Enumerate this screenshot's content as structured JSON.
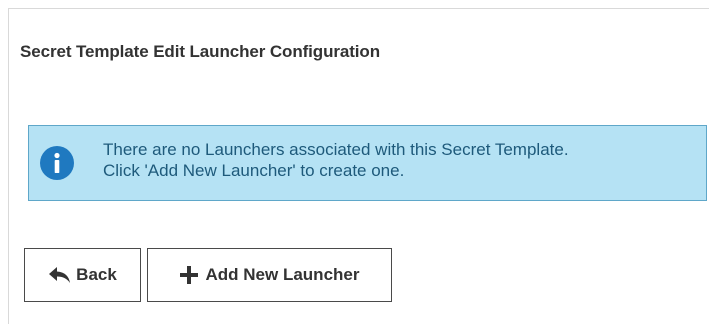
{
  "page": {
    "title": "Secret Template Edit Launcher Configuration"
  },
  "alert": {
    "type": "info",
    "icon": "info-icon",
    "line1": "There are no Launchers associated with this Secret Template.",
    "line2": "Click 'Add New Launcher' to create one."
  },
  "buttons": {
    "back_label": "Back",
    "back_icon": "reply-arrow-icon",
    "add_label": "Add New Launcher",
    "add_icon": "plus-icon"
  },
  "colors": {
    "alert_background": "#b5e2f4",
    "alert_border": "#5fa7c9",
    "alert_text": "#1e5a7b",
    "info_icon": "#1f79c0"
  }
}
